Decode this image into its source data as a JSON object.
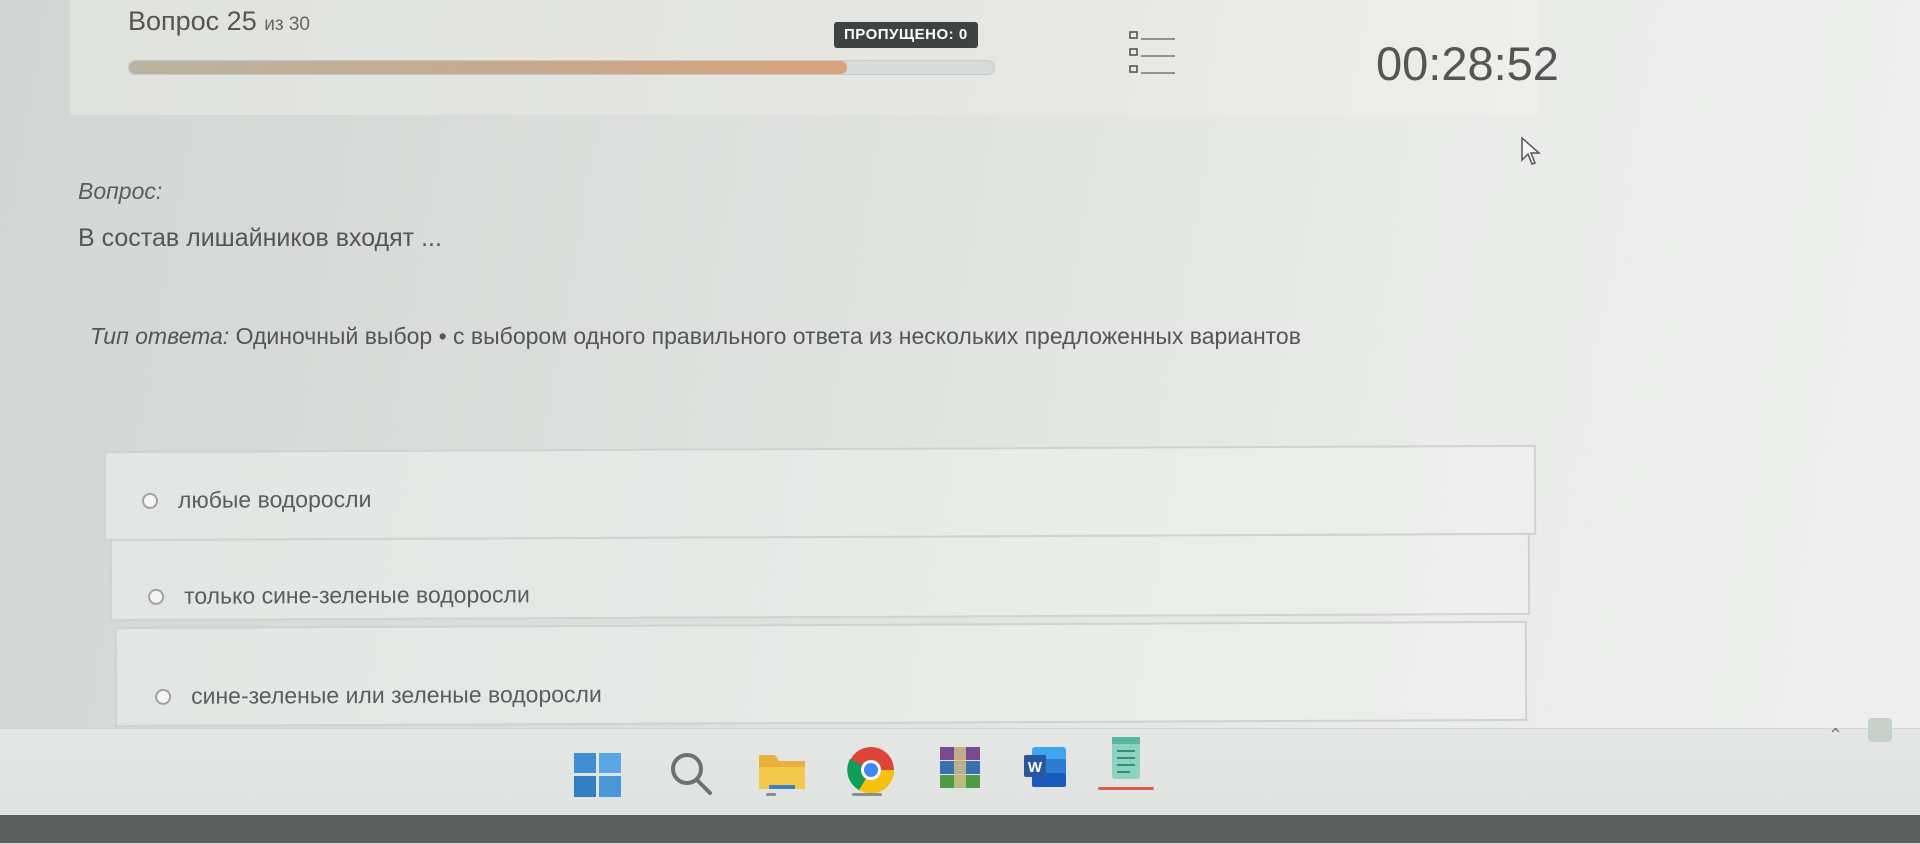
{
  "header": {
    "question_prefix": "Вопрос 25",
    "question_of": "из 30",
    "progress_fraction": 0.83,
    "skipped_label": "ПРОПУЩЕНО: 0",
    "timer": "00:28:52"
  },
  "question": {
    "label": "Вопрос:",
    "text": "В состав лишайников входят ...",
    "answer_type_label": "Тип ответа:",
    "answer_type_value": "Одиночный выбор • с выбором одного правильного ответа из нескольких предложенных вариантов"
  },
  "options": [
    {
      "text": "любые водоросли"
    },
    {
      "text": "только сине-зеленые водоросли"
    },
    {
      "text": "сине-зеленые или зеленые водоросли"
    }
  ],
  "taskbar": {
    "icons": [
      "windows-start-icon",
      "search-icon",
      "file-explorer-icon",
      "chrome-icon",
      "winrar-icon",
      "word-icon",
      "notepad-icon"
    ],
    "colors": {
      "accent": "#e8a85a",
      "word": "#2b579a",
      "chrome_red": "#db4437",
      "active": "#e05a4a"
    }
  },
  "colors": {
    "progress_fill": "#d9a27a",
    "badge_bg": "#3e4342"
  }
}
